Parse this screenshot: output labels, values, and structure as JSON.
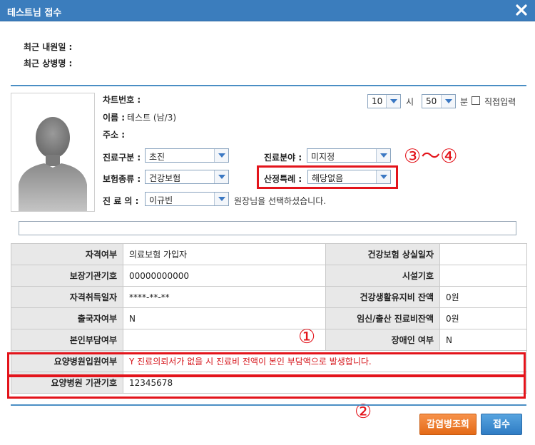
{
  "window": {
    "title": "테스트님 접수"
  },
  "recent": {
    "last_visit_label": "최근 내원일 :",
    "last_diagnosis_label": "최근 상병명 :"
  },
  "time": {
    "hour_value": "10",
    "hour_label": "시",
    "minute_value": "50",
    "minute_label": "분",
    "direct_input_label": "직접입력"
  },
  "patient": {
    "chart_no_label": "차트번호 :",
    "name_label": "이름 :",
    "name_value": "테스트 (남/3)",
    "address_label": "주소 :"
  },
  "form": {
    "visit_type_label": "진료구분 :",
    "visit_type_value": "초진",
    "dept_label": "진료분야 :",
    "dept_value": "미지정",
    "insurance_label": "보험종류 :",
    "insurance_value": "건강보험",
    "special_label": "산정특례 :",
    "special_value": "해당없음",
    "doctor_label": "진 료 의 :",
    "doctor_value": "이규빈",
    "doctor_msg": "원장님을 선택하셨습니다."
  },
  "annotations": {
    "a1": "①",
    "a2": "②",
    "a34": "③～④"
  },
  "table": {
    "rows": [
      {
        "h1": "자격여부",
        "d1": "의료보험 가입자",
        "h2": "건강보험 상실일자",
        "d2": ""
      },
      {
        "h1": "보장기관기호",
        "d1": "00000000000",
        "h2": "시설기호",
        "d2": ""
      },
      {
        "h1": "자격취득일자",
        "d1": "****-**-**",
        "h2": "건강생활유지비 잔액",
        "d2": "0원"
      },
      {
        "h1": "출국자여부",
        "d1": "N",
        "h2": "임신/출산 진료비잔액",
        "d2": "0원"
      },
      {
        "h1": "본인부담여부",
        "d1": "",
        "h2": "장애인 여부",
        "d2": "N"
      }
    ],
    "care_hospital_label": "요양병원입원여부",
    "care_hospital_value": "Y 진료의뢰서가 없을 시 진료비 전액이 본인 부담액으로 발생합니다.",
    "care_code_label": "요양병원 기관기호",
    "care_code_value": "12345678"
  },
  "buttons": {
    "history": "감염병조회",
    "submit": "접수"
  },
  "colors": {
    "title_bar": "#3b7dbd",
    "accent_red": "#e3141b",
    "orange_button": "#e46a17",
    "blue_button": "#2f7cc4"
  }
}
